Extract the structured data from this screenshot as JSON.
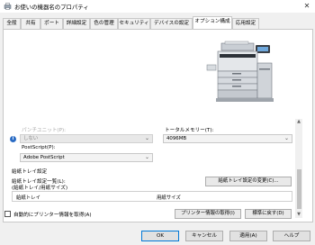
{
  "window": {
    "title": "お使いの機器名のプロパティ"
  },
  "tabs": [
    {
      "label": "全般",
      "active": false
    },
    {
      "label": "共有",
      "active": false
    },
    {
      "label": "ポート",
      "active": false
    },
    {
      "label": "詳細設定",
      "active": false
    },
    {
      "label": "色の管理",
      "active": false
    },
    {
      "label": "セキュリティ",
      "active": false
    },
    {
      "label": "デバイスの設定",
      "active": false
    },
    {
      "label": "オプション構成",
      "active": true
    },
    {
      "label": "応用設定",
      "active": false
    }
  ],
  "options": {
    "punch_unit": {
      "label": "パンチユニット(P):",
      "value": "しない"
    },
    "total_memory": {
      "label": "トータルメモリー(T):",
      "value": "4096MB"
    },
    "postscript": {
      "label": "PostScript(P):",
      "value": "Adobe PostScript"
    }
  },
  "paper_tray": {
    "section_title": "給紙トレイ設定",
    "list_label_1": "給紙トレイ設定一覧(L):",
    "list_label_2": "(給紙トレイ/用紙サイズ)",
    "change_button": "給紙トレイ設定の変更(C)...",
    "col_tray": "給紙トレイ",
    "col_size": "用紙サイズ"
  },
  "bottom": {
    "auto_get_checkbox": "自動的にプリンター情報を取得(A)",
    "get_info_button": "プリンター情報の取得(I)",
    "reset_button": "標準に戻す(D)"
  },
  "footer": {
    "ok": "OK",
    "cancel": "キャンセル",
    "apply": "適用(A)",
    "help": "ヘルプ"
  }
}
